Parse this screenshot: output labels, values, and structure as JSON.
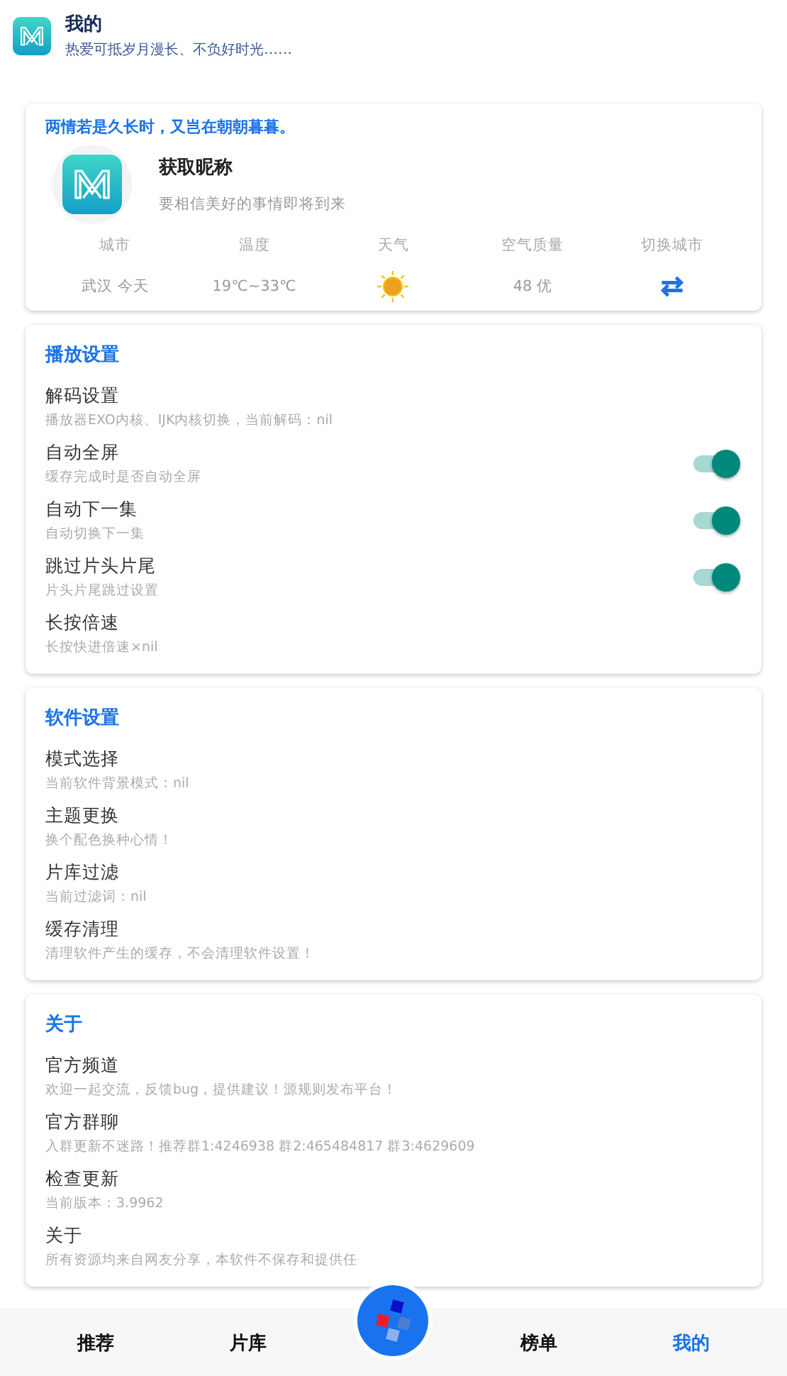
{
  "header": {
    "title": "我的",
    "subtitle": "热爱可抵岁月漫长、不负好时光……"
  },
  "profile": {
    "quote": "两情若是久长时，又岂在朝朝暮暮。",
    "name": "获取昵称",
    "motto": "要相信美好的事情即将到来",
    "weather": [
      {
        "label": "城市",
        "value": "武汉 今天",
        "kind": "text"
      },
      {
        "label": "温度",
        "value": "19℃~33℃",
        "kind": "text"
      },
      {
        "label": "天气",
        "kind": "sun"
      },
      {
        "label": "空气质量",
        "value": "48 优",
        "kind": "text"
      },
      {
        "label": "切换城市",
        "kind": "switch"
      }
    ]
  },
  "sections": [
    {
      "title": "播放设置",
      "items": [
        {
          "kind": "link",
          "title": "解码设置",
          "desc": "播放器EXO内核、IJK内核切换，当前解码：nil"
        },
        {
          "kind": "switch",
          "title": "自动全屏",
          "desc": "缓存完成时是否自动全屏",
          "on": true
        },
        {
          "kind": "switch",
          "title": "自动下一集",
          "desc": "自动切换下一集",
          "on": true
        },
        {
          "kind": "switch",
          "title": "跳过片头片尾",
          "desc": "片头片尾跳过设置",
          "on": true
        },
        {
          "kind": "link",
          "title": "长按倍速",
          "desc": "长按快进倍速×nil"
        }
      ]
    },
    {
      "title": "软件设置",
      "items": [
        {
          "kind": "link",
          "title": "模式选择",
          "desc": "当前软件背景模式：nil"
        },
        {
          "kind": "link",
          "title": "主题更换",
          "desc": "换个配色换种心情！"
        },
        {
          "kind": "link",
          "title": "片库过滤",
          "desc": "当前过滤词：nil"
        },
        {
          "kind": "link",
          "title": "缓存清理",
          "desc": "清理软件产生的缓存，不会清理软件设置！"
        }
      ]
    },
    {
      "title": "关于",
      "items": [
        {
          "kind": "link",
          "title": "官方频道",
          "desc": "欢迎一起交流，反馈bug，提供建议！源规则发布平台！"
        },
        {
          "kind": "link",
          "title": "官方群聊",
          "desc": "入群更新不迷路！推荐群1:4246938  群2:465484817  群3:4629609"
        },
        {
          "kind": "link",
          "title": "检查更新",
          "desc": "当前版本：3.9962"
        },
        {
          "kind": "link",
          "title": "关于",
          "desc": "所有资源均来自网友分享，本软件不保存和提供任"
        }
      ]
    }
  ],
  "nav": [
    {
      "label": "推荐",
      "selected": false
    },
    {
      "label": "片库",
      "selected": false
    },
    {
      "kind": "center"
    },
    {
      "label": "榜单",
      "selected": false
    },
    {
      "label": "我的",
      "selected": true
    }
  ]
}
